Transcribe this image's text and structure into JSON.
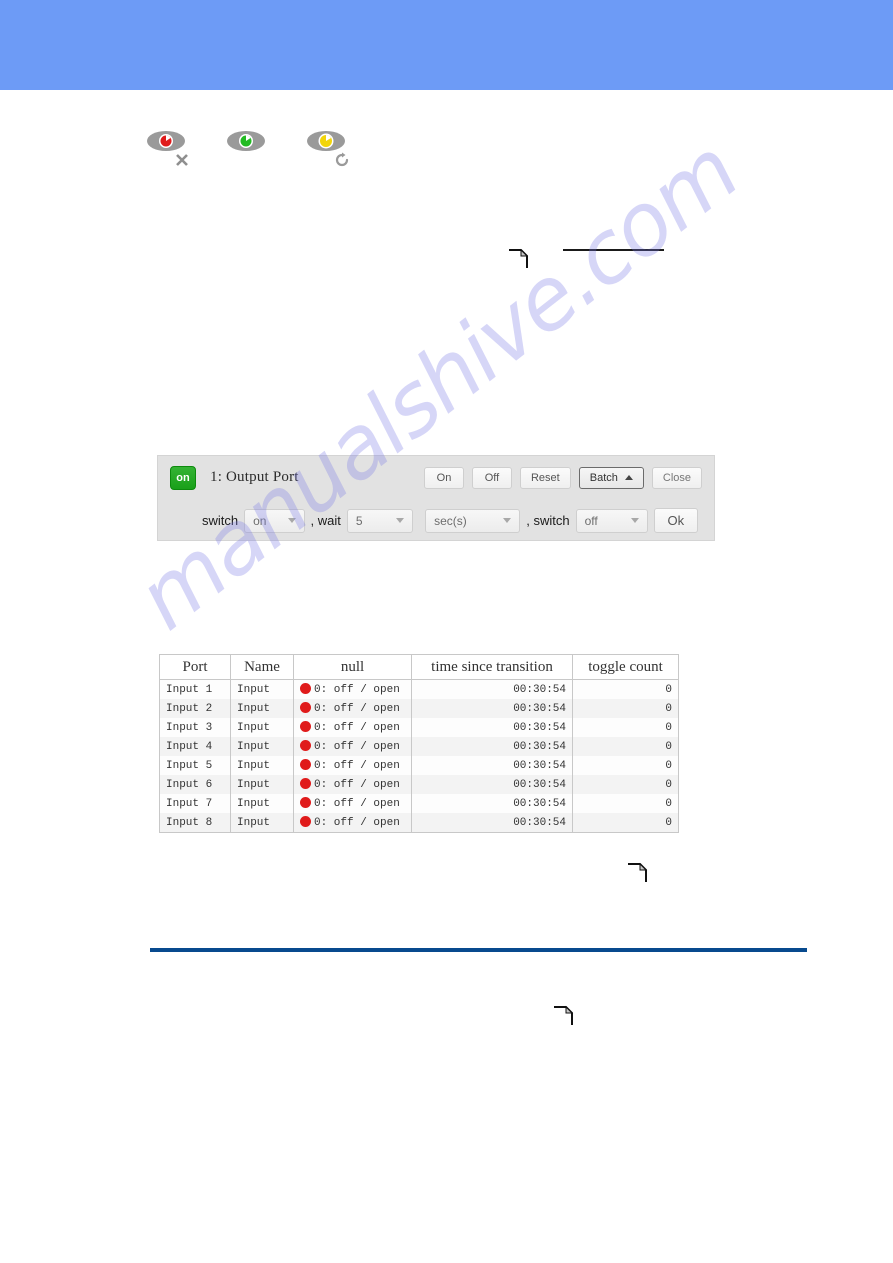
{
  "page": {
    "banner_color": "#6d9bf6",
    "divider_color": "#084a8e",
    "watermark_text": "manualshive.com"
  },
  "icon_row": {
    "icons": [
      {
        "name": "eye-red-disabled",
        "pupil_color": "#e01b1b",
        "badge": "cross"
      },
      {
        "name": "eye-green-active",
        "pupil_color": "#22bb22",
        "badge": "none"
      },
      {
        "name": "eye-yellow-refresh",
        "pupil_color": "#f2d50a",
        "badge": "refresh"
      }
    ]
  },
  "port_panel": {
    "status_badge": "on",
    "title": "1: Output Port",
    "buttons": {
      "on": "On",
      "off": "Off",
      "reset": "Reset",
      "batch": "Batch",
      "close": "Close",
      "ok": "Ok"
    },
    "batch_row": {
      "label_switch_1": "switch",
      "value_switch_1": "on",
      "label_wait": ", wait",
      "value_wait": "5",
      "value_unit": "sec(s)",
      "label_switch_2": ", switch",
      "value_switch_2": "off"
    }
  },
  "status_table": {
    "headers": [
      "Port",
      "Name",
      "null",
      "time since transition",
      "toggle count"
    ],
    "rows": [
      {
        "port": "Input 1",
        "name": "Input",
        "state": "0: off / open",
        "time": "00:30:54",
        "toggle": "0"
      },
      {
        "port": "Input 2",
        "name": "Input",
        "state": "0: off / open",
        "time": "00:30:54",
        "toggle": "0"
      },
      {
        "port": "Input 3",
        "name": "Input",
        "state": "0: off / open",
        "time": "00:30:54",
        "toggle": "0"
      },
      {
        "port": "Input 4",
        "name": "Input",
        "state": "0: off / open",
        "time": "00:30:54",
        "toggle": "0"
      },
      {
        "port": "Input 5",
        "name": "Input",
        "state": "0: off / open",
        "time": "00:30:54",
        "toggle": "0"
      },
      {
        "port": "Input 6",
        "name": "Input",
        "state": "0: off / open",
        "time": "00:30:54",
        "toggle": "0"
      },
      {
        "port": "Input 7",
        "name": "Input",
        "state": "0: off / open",
        "time": "00:30:54",
        "toggle": "0"
      },
      {
        "port": "Input 8",
        "name": "Input",
        "state": "0: off / open",
        "time": "00:30:54",
        "toggle": "0"
      }
    ]
  }
}
